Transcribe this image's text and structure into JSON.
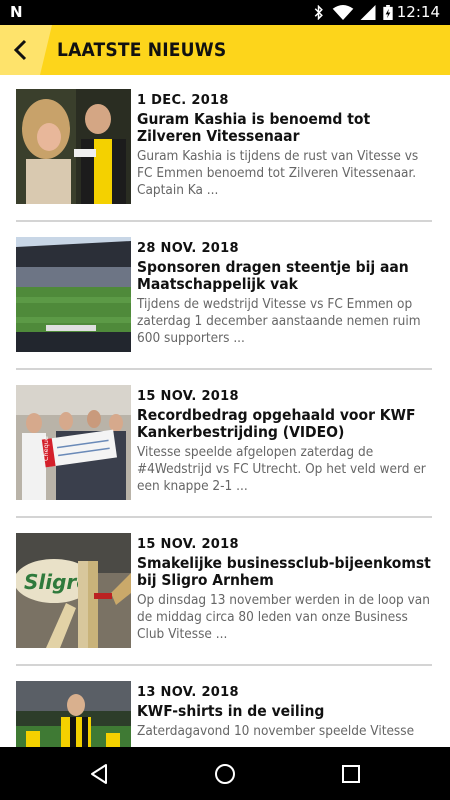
{
  "status_bar": {
    "time": "12:14",
    "icons": [
      "n-logo-icon",
      "bluetooth-icon",
      "wifi-icon",
      "cellular-signal-icon",
      "battery-charging-icon"
    ],
    "n_logo": "N"
  },
  "header": {
    "title": "LAATSTE NIEUWS",
    "background_color": "#fdd51b",
    "back_icon": "chevron-left-icon"
  },
  "news": [
    {
      "date": "1 DEC. 2018",
      "title": "Guram Kashia is benoemd tot Zilveren Vitessenaar",
      "excerpt": "Guram Kashia is tijdens de rust van Vitesse vs FC Emmen benoemd tot Zilveren Vitessenaar. Captain Ka ..."
    },
    {
      "date": "28 NOV. 2018",
      "title": "Sponsoren dragen steentje bij aan Maatschappelijk vak",
      "excerpt": "Tijdens de wedstrijd Vitesse vs FC Emmen op zaterdag 1 december aanstaande nemen ruim 600 supporters ..."
    },
    {
      "date": "15 NOV. 2018",
      "title": "Recordbedrag opgehaald voor KWF Kankerbestrijding (VIDEO)",
      "excerpt": "Vitesse speelde afgelopen zaterdag de #4Wedstrijd vs FC Utrecht. Op het veld werd er een knappe 2-1  ..."
    },
    {
      "date": "15 NOV. 2018",
      "title": "Smakelijke businessclub-bijeenkomst bij Sligro Arnhem",
      "excerpt": "Op dinsdag 13 november werden in de loop van de middag circa 80 leden van onze Business Club Vitesse ..."
    },
    {
      "date": "13 NOV. 2018",
      "title": "KWF-shirts in de veiling",
      "excerpt": "Zaterdagavond 10 november speelde Vitesse"
    }
  ],
  "thumb_labels": {
    "cheque": "Cheque",
    "sligro": "Sligro"
  },
  "nav_bar": {
    "buttons": [
      "back-triangle-icon",
      "home-circle-icon",
      "recents-square-icon"
    ]
  }
}
